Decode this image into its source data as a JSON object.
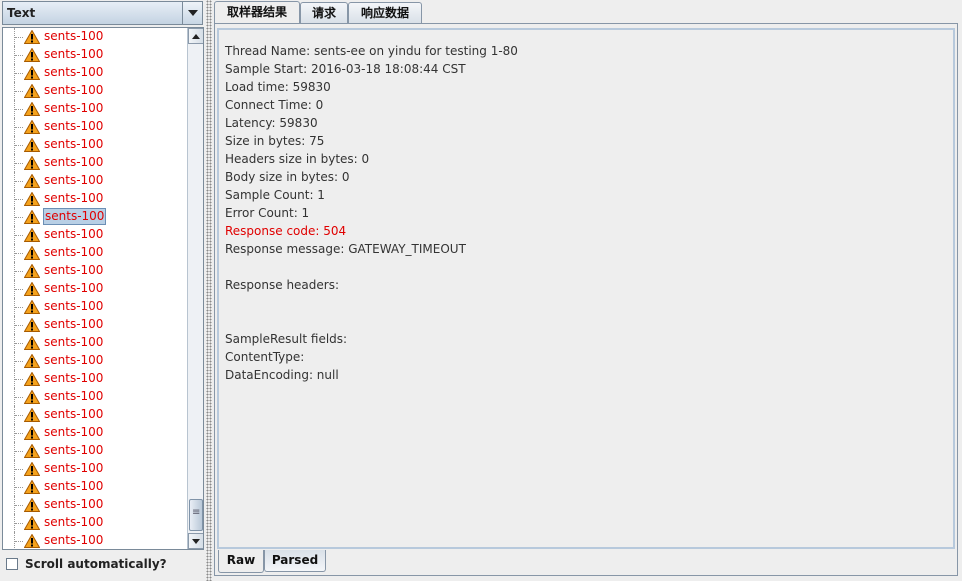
{
  "filter_combo": {
    "selected": "Text"
  },
  "tree": {
    "items": [
      "sents-100",
      "sents-100",
      "sents-100",
      "sents-100",
      "sents-100",
      "sents-100",
      "sents-100",
      "sents-100",
      "sents-100",
      "sents-100",
      "sents-100",
      "sents-100",
      "sents-100",
      "sents-100",
      "sents-100",
      "sents-100",
      "sents-100",
      "sents-100",
      "sents-100",
      "sents-100",
      "sents-100",
      "sents-100",
      "sents-100",
      "sents-100",
      "sents-100",
      "sents-100",
      "sents-100",
      "sents-100",
      "sents-100"
    ],
    "selected_index": 10,
    "item_icon": "warning-icon",
    "item_color": "#e00000"
  },
  "scroll_auto": {
    "label": "Scroll automatically?",
    "checked": false
  },
  "tabs": [
    "取样器结果",
    "请求",
    "响应数据"
  ],
  "active_tab": 0,
  "sample_result": {
    "lines": [
      "Thread Name: sents-ee on yindu for testing 1-80",
      "Sample Start: 2016-03-18 18:08:44 CST",
      "Load time: 59830",
      "Connect Time: 0",
      "Latency: 59830",
      "Size in bytes: 75",
      "Headers size in bytes: 0",
      "Body size in bytes: 0",
      "Sample Count: 1",
      "Error Count: 1",
      "Response code: 504",
      "Response message: GATEWAY_TIMEOUT",
      "",
      "Response headers:",
      "",
      "",
      "SampleResult fields:",
      "ContentType: ",
      "DataEncoding: null"
    ],
    "highlight_line": 10,
    "highlight_color": "#e00000"
  },
  "bottom_tabs": [
    "Raw",
    "Parsed"
  ],
  "active_bottom_tab": 0
}
